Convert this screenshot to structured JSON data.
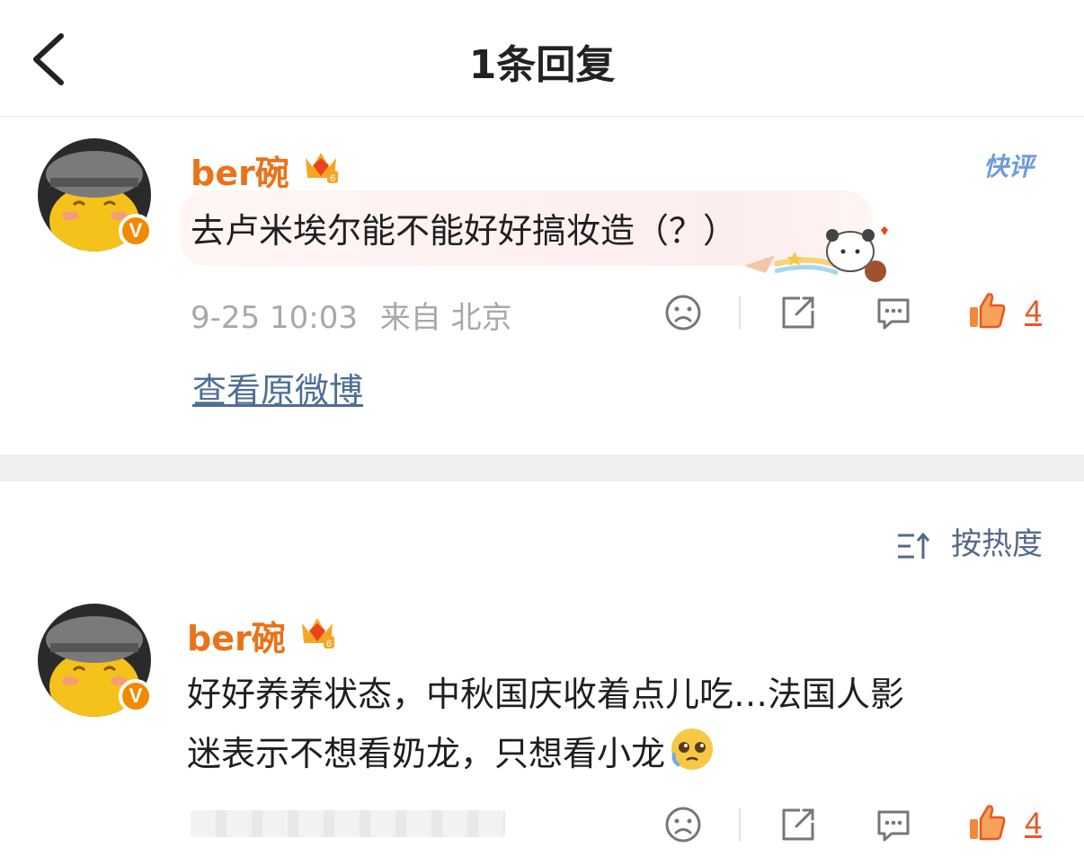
{
  "header": {
    "title": "1条回复",
    "back_icon": "chevron-left-icon"
  },
  "root_comment": {
    "username": "ber碗",
    "level_badge": "6",
    "verified_badge": "V",
    "text": "去卢米埃尔能不能好好搞妆造（？）",
    "quick_comment_label": "快评",
    "timestamp": "9-25 10:03",
    "location": "来自 北京",
    "like_count": "4",
    "view_original": "查看原微博"
  },
  "sort": {
    "label": "按热度",
    "icon": "sort-icon"
  },
  "replies": [
    {
      "username": "ber碗",
      "level_badge": "6",
      "verified_badge": "V",
      "text_line1": "好好养养状态，中秋国庆收着点儿吃…法国人影",
      "text_line2": "迷表示不想看奶龙，只想看小龙",
      "emoji": "pleading-face-emoji",
      "like_count": "4"
    }
  ],
  "colors": {
    "accent_orange": "#eb7219",
    "like_red": "#e8561e",
    "link_blue": "#4e6e96",
    "meta_gray": "#a8a8a8"
  }
}
